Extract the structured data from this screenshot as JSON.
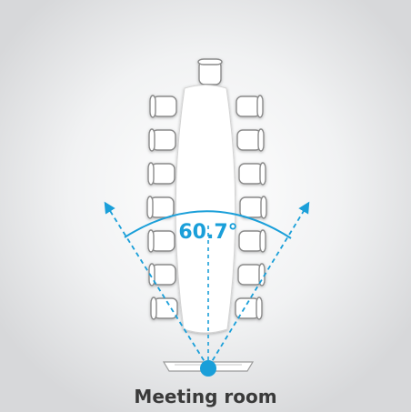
{
  "diagram": {
    "fov_angle": "60.7°",
    "room_label": "Meeting room",
    "chairs_per_side": 7,
    "head_chairs": 1,
    "colors": {
      "accent": "#1a9fd9",
      "background_center": "#ffffff",
      "background_edge": "#d7d8da",
      "chair_stroke": "#8a8a8a",
      "table_fill": "#ffffff",
      "label_text": "#3a3a3a"
    },
    "icons": {
      "camera": "camera-dot-icon"
    }
  }
}
